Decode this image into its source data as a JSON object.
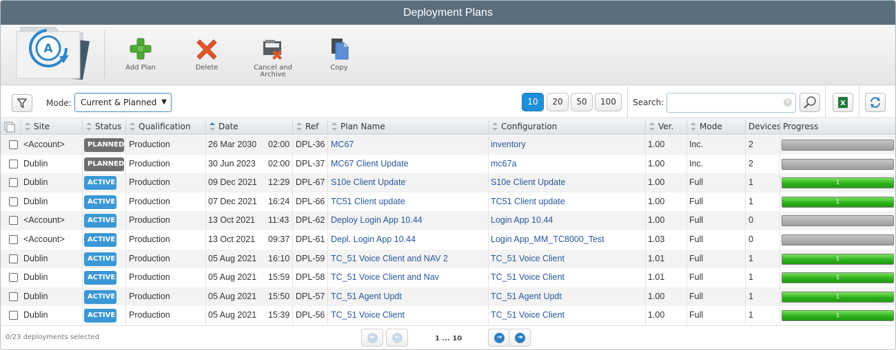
{
  "window": {
    "title": "Deployment Plans"
  },
  "toolbar": {
    "add_plan": "Add Plan",
    "delete": "Delete",
    "cancel_archive_line1": "Cancel and",
    "cancel_archive_line2": "Archive",
    "copy": "Copy"
  },
  "filters": {
    "mode_label": "Mode:",
    "mode_value": "Current & Planned",
    "page_sizes": [
      "10",
      "20",
      "50",
      "100"
    ],
    "page_size_selected": "10",
    "search_label": "Search:",
    "search_value": ""
  },
  "table": {
    "headers": {
      "site": "Site",
      "status": "Status",
      "qualification": "Qualification",
      "date": "Date",
      "ref": "Ref",
      "plan_name": "Plan Name",
      "configuration": "Configuration",
      "ver": "Ver.",
      "mode": "Mode",
      "devices": "Devices",
      "progress": "Progress"
    },
    "sorted_column": "date",
    "rows": [
      {
        "site": "<Account>",
        "status": "PLANNED",
        "qualification": "Production",
        "date": "26 Mar 2030",
        "time": "02:00",
        "ref": "DPL-36",
        "plan_name": "MC67",
        "configuration": "inventory",
        "ver": "1.00",
        "mode": "Inc.",
        "devices": "2",
        "progress": 0,
        "progress_label": ""
      },
      {
        "site": "Dublin",
        "status": "PLANNED",
        "qualification": "Production",
        "date": "30 Jun 2023",
        "time": "02:00",
        "ref": "DPL-37",
        "plan_name": "MC67 Client Update",
        "configuration": "mc67a",
        "ver": "1.00",
        "mode": "Inc.",
        "devices": "2",
        "progress": 0,
        "progress_label": ""
      },
      {
        "site": "Dublin",
        "status": "ACTIVE",
        "qualification": "Production",
        "date": "09 Dec 2021",
        "time": "12:29",
        "ref": "DPL-67",
        "plan_name": "S10e Client Update",
        "configuration": "S10e Client Update",
        "ver": "1.00",
        "mode": "Full",
        "devices": "1",
        "progress": 1,
        "progress_label": "1"
      },
      {
        "site": "Dublin",
        "status": "ACTIVE",
        "qualification": "Production",
        "date": "07 Dec 2021",
        "time": "16:24",
        "ref": "DPL-66",
        "plan_name": "TC51 Client update",
        "configuration": "TC51 Client update",
        "ver": "1.00",
        "mode": "Full",
        "devices": "1",
        "progress": 1,
        "progress_label": "1"
      },
      {
        "site": "<Account>",
        "status": "ACTIVE",
        "qualification": "Production",
        "date": "13 Oct 2021",
        "time": "11:43",
        "ref": "DPL-62",
        "plan_name": "Deploy Login App 10.44",
        "configuration": "Login App 10.44",
        "ver": "1.00",
        "mode": "Full",
        "devices": "0",
        "progress": 0,
        "progress_label": ""
      },
      {
        "site": "<Account>",
        "status": "ACTIVE",
        "qualification": "Production",
        "date": "13 Oct 2021",
        "time": "09:37",
        "ref": "DPL-61",
        "plan_name": "Depl. Login App 10.44",
        "configuration": "Login App_MM_TC8000_Test",
        "ver": "1.03",
        "mode": "Full",
        "devices": "0",
        "progress": 0,
        "progress_label": ""
      },
      {
        "site": "Dublin",
        "status": "ACTIVE",
        "qualification": "Production",
        "date": "05 Aug 2021",
        "time": "16:10",
        "ref": "DPL-59",
        "plan_name": "TC_51 Voice Client and NAV 2",
        "configuration": "TC_51 Voice Client",
        "ver": "1.01",
        "mode": "Full",
        "devices": "1",
        "progress": 1,
        "progress_label": "1"
      },
      {
        "site": "Dublin",
        "status": "ACTIVE",
        "qualification": "Production",
        "date": "05 Aug 2021",
        "time": "15:59",
        "ref": "DPL-58",
        "plan_name": "TC_51 Voice Client and Nav",
        "configuration": "TC_51 Voice Client",
        "ver": "1.01",
        "mode": "Full",
        "devices": "1",
        "progress": 1,
        "progress_label": "1"
      },
      {
        "site": "Dublin",
        "status": "ACTIVE",
        "qualification": "Production",
        "date": "05 Aug 2021",
        "time": "15:50",
        "ref": "DPL-57",
        "plan_name": "TC_51 Agent Updt",
        "configuration": "TC_51 Agent Updt",
        "ver": "1.00",
        "mode": "Full",
        "devices": "1",
        "progress": 1,
        "progress_label": "1"
      },
      {
        "site": "Dublin",
        "status": "ACTIVE",
        "qualification": "Production",
        "date": "05 Aug 2021",
        "time": "15:39",
        "ref": "DPL-56",
        "plan_name": "TC_51 Voice Client",
        "configuration": "TC_51 Voice Client",
        "ver": "1.00",
        "mode": "Full",
        "devices": "1",
        "progress": 1,
        "progress_label": "1"
      }
    ]
  },
  "footer": {
    "selection_status": "0/23 deployments selected",
    "page_range": "1 ... 10"
  },
  "colors": {
    "title_bar": "#5a6e7c",
    "active_badge": "#3a98d6",
    "planned_badge": "#6f6f6f",
    "link": "#29579b",
    "progress_green": "#2fb21d",
    "page_size_active": "#1f8fd8"
  },
  "icons": [
    "app-logo-icon",
    "add-icon",
    "delete-icon",
    "cancel-archive-icon",
    "copy-icon",
    "filter-icon",
    "search-icon",
    "excel-export-icon",
    "refresh-icon",
    "first-page-icon",
    "prev-page-icon",
    "next-page-icon",
    "last-page-icon"
  ]
}
